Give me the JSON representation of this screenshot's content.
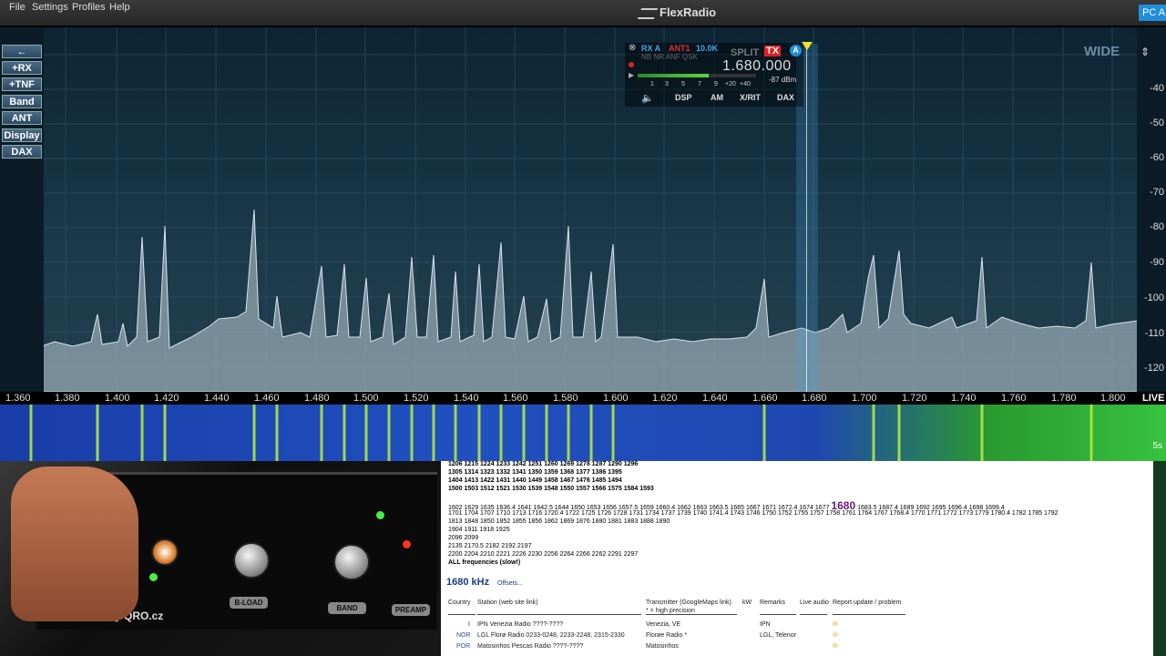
{
  "menu": {
    "items": [
      "File",
      "Settings",
      "Profiles",
      "Help"
    ]
  },
  "app": {
    "brand": "FlexRadio",
    "profile_badge": "PC A"
  },
  "left_buttons": [
    "←",
    "+RX",
    "+TNF",
    "Band",
    "ANT",
    "Display",
    "DAX"
  ],
  "pan_mode": "WIDE",
  "dbm_scale": [
    "-40",
    "-50",
    "-60",
    "-70",
    "-80",
    "-90",
    "-100",
    "-110",
    "-120"
  ],
  "slice": {
    "rx": "RX A",
    "ant": "ANT1",
    "filter": "10.0K",
    "flags": "NB NR ANF QSK",
    "split": "SPLIT",
    "tx": "TX",
    "letter": "A",
    "frequency": "1.680.000",
    "meter_scale": [
      "1",
      "3",
      "5",
      "7",
      "9",
      "+20",
      "+40"
    ],
    "signal": "-87 dBm",
    "buttons": [
      "DSP",
      "AM",
      "X/RIT",
      "DAX"
    ],
    "color_accent": "#1e8fd8"
  },
  "freq_axis": {
    "ticks": [
      "1.360",
      "1.380",
      "1.400",
      "1.420",
      "1.440",
      "1.460",
      "1.480",
      "1.500",
      "1.520",
      "1.540",
      "1.560",
      "1.580",
      "1.600",
      "1.620",
      "1.640",
      "1.660",
      "1.680",
      "1.700",
      "1.720",
      "1.740",
      "1.760",
      "1.780",
      "1.800"
    ],
    "live_label": "LIVE"
  },
  "waterfall": {
    "time_label": "5s"
  },
  "device": {
    "label": "ANT SWITCH by QRO.cz",
    "buttons": [
      "B-LOAD",
      "BAND",
      "PREAMP"
    ]
  },
  "webpage": {
    "freq_lines": [
      "1206 1215 1224 1233 1242 1251 1260 1269 1278 1287 1290 1296",
      "1305 1314 1323 1332 1341 1350 1359 1368 1377 1386 1395",
      "1404 1413 1422 1431 1440 1449 1458 1467 1476 1485 1494",
      "1500 1503 1512 1521 1530 1539 1548 1550 1557 1566 1575 1584 1593",
      "",
      "1602 1629 1635 1636.4 1641 1642.5 1644 1650 1653 1656 1657.5 1659 1660.4 1662 1663 1663.5 1665 1667 1671 1672.4 1674 1677",
      "1701 1704 1707 1710 1713 1716 1720.4 1722 1725 1726 1728 1731 1734 1737 1739 1740 1741.4 1743 1746 1750 1752 1755 1757 1758 1761 1764 1767 1768.4 1770 1771 1772 1773 1779 1780.4 1782 1785 1792",
      "1813 1848 1850 1852 1855 1856 1862 1869 1876 1880 1881 1883 1888 1890",
      "1904 1911 1918 1925",
      "2096 2099",
      "2135 2170.5 2182 2192 2197",
      "2200 2204 2210 2221 2226 2230 2256 2264 2266 2262 2291 2297"
    ],
    "highlight_freq": "1680",
    "after_highlight": "1683.5 1687.4 1689 1692 1695 1696.4 1698 1699.4",
    "all_freq": "ALL frequencies (slow!)",
    "heading": "1680 kHz",
    "offsets": "Offsets...",
    "columns": [
      "Country",
      "Station (web site link)",
      "Transmitter (GoogleMaps link)",
      "* = high precision",
      "kW",
      "Remarks",
      "Live audio",
      "Report update / problem"
    ],
    "rows": [
      {
        "country": "I",
        "station": "IPN Venezia Radio ????-????",
        "tx": "Venezia, VE",
        "remarks": "IPN"
      },
      {
        "country": "NOR",
        "station": "LGL Florø Radio 0233-0248, 2233-2248, 2315-2330",
        "tx": "Florøe Radio *",
        "remarks": "LGL, Telenor"
      },
      {
        "country": "POR",
        "station": "Matosinhos Pescas Radio ????-????",
        "tx": "Matosinhos",
        "remarks": ""
      }
    ]
  }
}
